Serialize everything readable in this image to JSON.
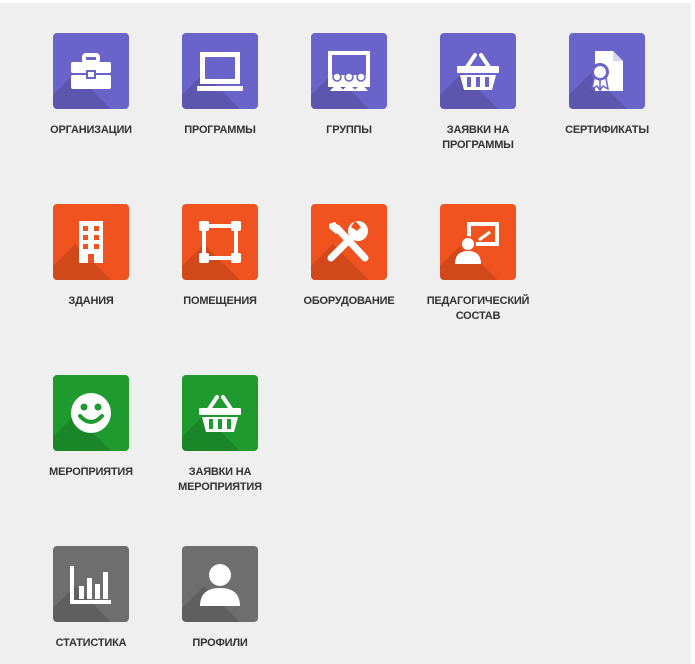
{
  "colors": {
    "purple": "#6a63c9",
    "orange": "#f0531f",
    "green": "#1e9a2e",
    "grey": "#6e6e6e",
    "background": "#efefef",
    "label": "#333333"
  },
  "rows": [
    {
      "tiles": [
        {
          "icon": "briefcase-icon",
          "label": "ОРГАНИЗАЦИИ"
        },
        {
          "icon": "laptop-icon",
          "label": "ПРОГРАММЫ"
        },
        {
          "icon": "classroom-icon",
          "label": "ГРУППЫ"
        },
        {
          "icon": "basket-icon",
          "label": "ЗАЯВКИ НА ПРОГРАММЫ"
        },
        {
          "icon": "certificate-icon",
          "label": "СЕРТИФИКАТЫ"
        }
      ]
    },
    {
      "tiles": [
        {
          "icon": "building-icon",
          "label": "ЗДАНИЯ"
        },
        {
          "icon": "room-icon",
          "label": "ПОМЕЩЕНИЯ"
        },
        {
          "icon": "tools-icon",
          "label": "ОБОРУДОВАНИЕ"
        },
        {
          "icon": "teacher-icon",
          "label": "ПЕДАГОГИЧЕСКИЙ СОСТАВ"
        }
      ]
    },
    {
      "tiles": [
        {
          "icon": "smiley-icon",
          "label": "МЕРОПРИЯТИЯ"
        },
        {
          "icon": "basket-icon",
          "label": "ЗАЯВКИ НА МЕРОПРИЯТИЯ"
        }
      ]
    },
    {
      "tiles": [
        {
          "icon": "bar-chart-icon",
          "label": "СТАТИСТИКА"
        },
        {
          "icon": "user-icon",
          "label": "ПРОФИЛИ"
        }
      ]
    }
  ]
}
